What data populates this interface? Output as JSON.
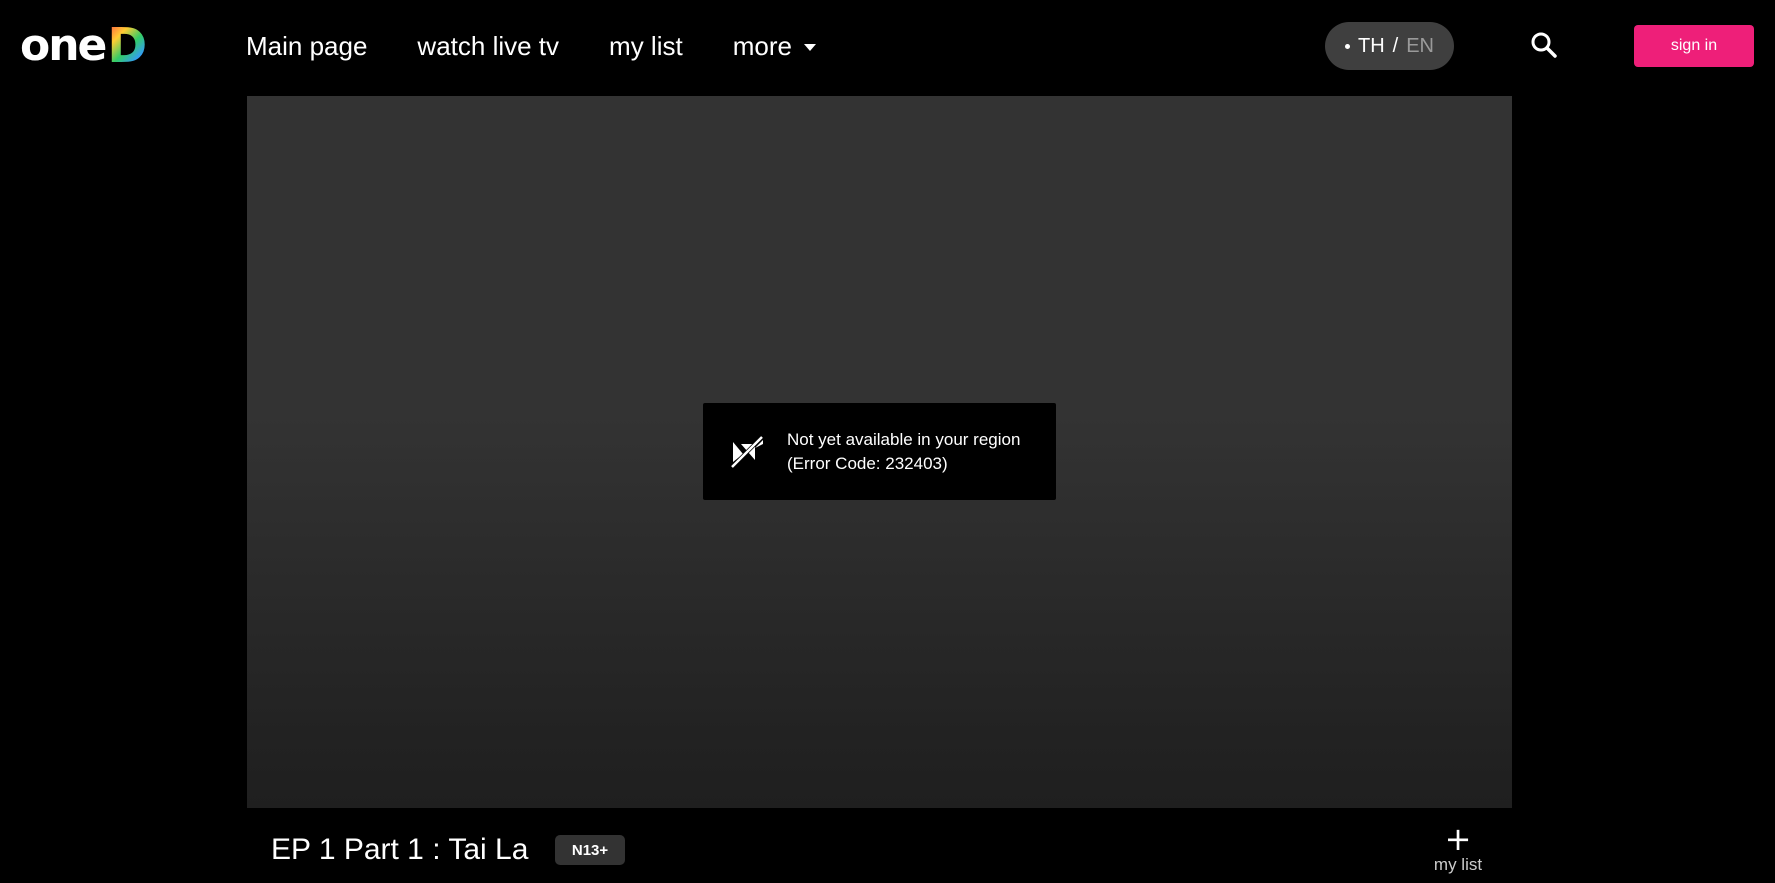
{
  "brand": {
    "logo_text_one": "one",
    "logo_text_d": "D"
  },
  "nav": {
    "items": [
      {
        "label": "Main page"
      },
      {
        "label": "watch live tv"
      },
      {
        "label": "my list"
      },
      {
        "label": "more"
      }
    ]
  },
  "language": {
    "active": "TH",
    "separator": "/",
    "inactive": "EN"
  },
  "actions": {
    "search_icon": "search-icon",
    "signin_label": "sign in",
    "signin_color": "#ee1f79"
  },
  "player": {
    "error_line1": "Not yet available in your region",
    "error_line2": "(Error Code: 232403)",
    "error_icon": "video-off-icon"
  },
  "episode": {
    "title": "EP 1 Part 1 : Tai La",
    "rating": "N13+",
    "mylist_label": "my list",
    "mylist_icon": "+"
  }
}
